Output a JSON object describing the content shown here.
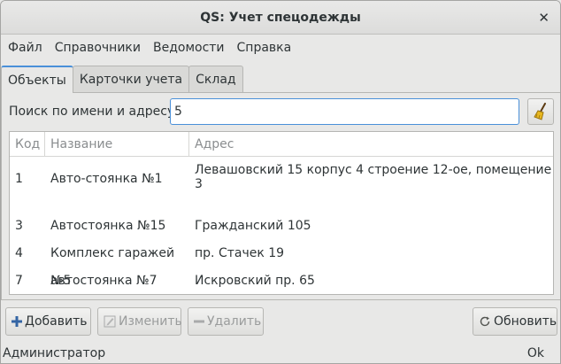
{
  "window": {
    "title": "QS: Учет спецодежды"
  },
  "menu": [
    "Файл",
    "Справочники",
    "Ведомости",
    "Справка"
  ],
  "tabs": [
    {
      "label": "Объекты",
      "active": true
    },
    {
      "label": "Карточки учета",
      "active": false
    },
    {
      "label": "Склад",
      "active": false
    }
  ],
  "search": {
    "label": "Поиск по имени и адресу:",
    "value": "5",
    "clear_icon": "broom-icon"
  },
  "table": {
    "columns": [
      "Код",
      "Название",
      "Адрес"
    ],
    "rows": [
      {
        "code": "1",
        "name": "Авто-стоянка №1",
        "address": "Левашовский 15 корпус 4 строение 12-ое, помещение 3"
      },
      {
        "code": "3",
        "name": "Автостоянка №15",
        "address": "Гражданский 105"
      },
      {
        "code": "4",
        "name": "Комплекс гаражей №5",
        "address": "пр. Стачек 19"
      },
      {
        "code": "7",
        "name": "автостоянка №7",
        "address": "Искровский пр. 65"
      }
    ]
  },
  "buttons": {
    "add": "Добавить",
    "edit": "Изменить",
    "delete": "Удалить",
    "refresh": "Обновить"
  },
  "status": {
    "user": "Администратор",
    "state": "Ok"
  },
  "colors": {
    "accent": "#4a90d9",
    "window_bg": "#e8e8e7",
    "add_icon": "#3465a4"
  }
}
